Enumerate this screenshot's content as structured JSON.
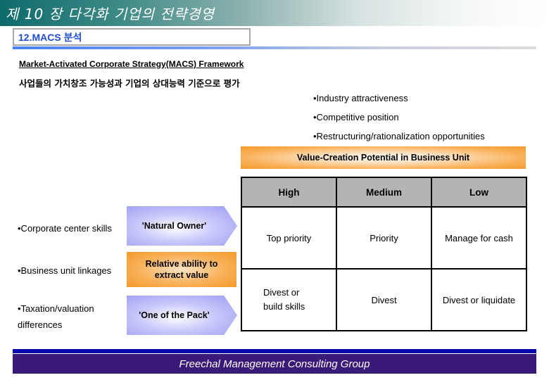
{
  "header": {
    "chapter_title": "제 10 장   다각화 기업의 전략경영",
    "section_title": "12.MACS 분석"
  },
  "framework": {
    "title": "Market-Activated Corporate Strategy(MACS) Framework",
    "subtitle": "사업들의 가치창조 가능성과 기업의 상대능력 기준으로 평가"
  },
  "criteria_bullets": [
    "•Industry attractiveness",
    "•Competitive position",
    "•Restructuring/rationalization opportunities"
  ],
  "value_header": "Value-Creation Potential in Business Unit",
  "matrix": {
    "columns": [
      "High",
      "Medium",
      "Low"
    ],
    "rows": [
      [
        "Top priority",
        "Priority",
        "Manage for cash"
      ],
      [
        "Divest or build skills",
        "Divest",
        "Divest or liquidate"
      ]
    ],
    "row2_col1_lines": [
      "Divest or",
      "build skills"
    ]
  },
  "ability_bullets": [
    "•Corporate center skills",
    "•Business unit linkages",
    "•Taxation/valuation",
    "differences"
  ],
  "labels": {
    "natural_owner": "'Natural Owner'",
    "relative_ability": "Relative ability to",
    "relative_ability_2": "extract value",
    "one_of_pack": "'One of the Pack'"
  },
  "footer": "Freechal Management Consulting Group",
  "colors": {
    "banner_start": "#0e6b6b",
    "section_text": "#1f4ecf",
    "orange": "#f39a2b",
    "chevron_blue": "#9c9cf2",
    "footer_bg": "#3a1a78",
    "footer_line": "#0a0aa8"
  }
}
